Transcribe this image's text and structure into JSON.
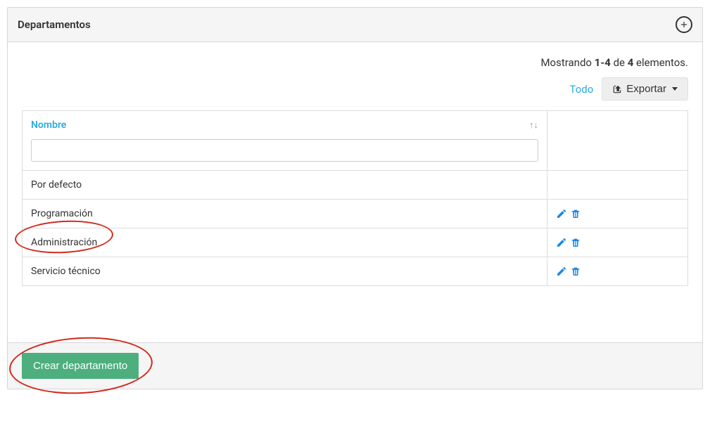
{
  "panel": {
    "title": "Departamentos"
  },
  "summary": {
    "prefix": "Mostrando ",
    "range": "1-4",
    "mid": " de ",
    "total": "4",
    "suffix": " elementos."
  },
  "controls": {
    "all_link": "Todo",
    "export_label": "Exportar"
  },
  "table": {
    "column_name": "Nombre",
    "filter_value": "",
    "rows": [
      {
        "name": "Por defecto",
        "editable": false
      },
      {
        "name": "Programación",
        "editable": true
      },
      {
        "name": "Administración",
        "editable": true
      },
      {
        "name": "Servicio técnico",
        "editable": true
      }
    ]
  },
  "footer": {
    "create_label": "Crear departamento"
  }
}
